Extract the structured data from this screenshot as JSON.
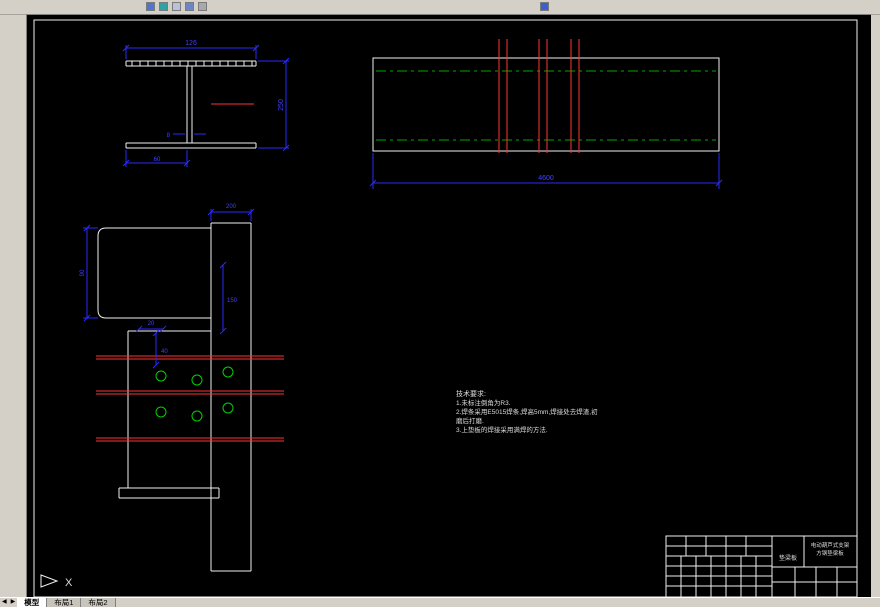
{
  "colors": {
    "canvas_background": "#000000",
    "drawing_line": "#f0f0f0",
    "dimension": "#2a2aff",
    "section_line": "#ff3232",
    "hole_circle": "#00d200",
    "centerline": "#00a800",
    "window_chrome": "#d4d0c8"
  },
  "toolbar": {
    "icons": [
      {
        "name": "new-icon",
        "color": "#4f74d2"
      },
      {
        "name": "open-icon",
        "color": "#2fa3a3"
      },
      {
        "name": "save-icon",
        "color": "#b9c2d6"
      },
      {
        "name": "plot-icon",
        "color": "#6b86c8"
      },
      {
        "name": "undo-icon",
        "color": "#a9a9a9"
      },
      {
        "name": "pan-icon",
        "color": "#3b5fd0"
      }
    ]
  },
  "views": {
    "section": {
      "dim_width": "126",
      "dim_height": "250",
      "dim_web": "8",
      "dim_bottom": "60"
    },
    "beam": {
      "dim_length": "4600"
    },
    "detail": {
      "dim_top": "200",
      "dim_left": "90",
      "dim_a": "20",
      "dim_b": "40",
      "dim_c": "150"
    }
  },
  "notes": {
    "title": "技术要求:",
    "lines": [
      "1.未标注倒角为R3.",
      "2.焊条采用E5015焊条,焊高5mm,焊接处去焊渣,初",
      "磨后打磨.",
      "3.上垫板的焊接采用满焊的方法."
    ]
  },
  "title_block": {
    "part_name": "垫梁板",
    "org_line1": "电动葫芦式支架",
    "org_line2": "方钢垫梁板"
  },
  "ucs": {
    "axis_label": "X"
  },
  "tabs": {
    "items": [
      {
        "label": "模型",
        "active": true
      },
      {
        "label": "布局1",
        "active": false
      },
      {
        "label": "布局2",
        "active": false
      }
    ]
  }
}
